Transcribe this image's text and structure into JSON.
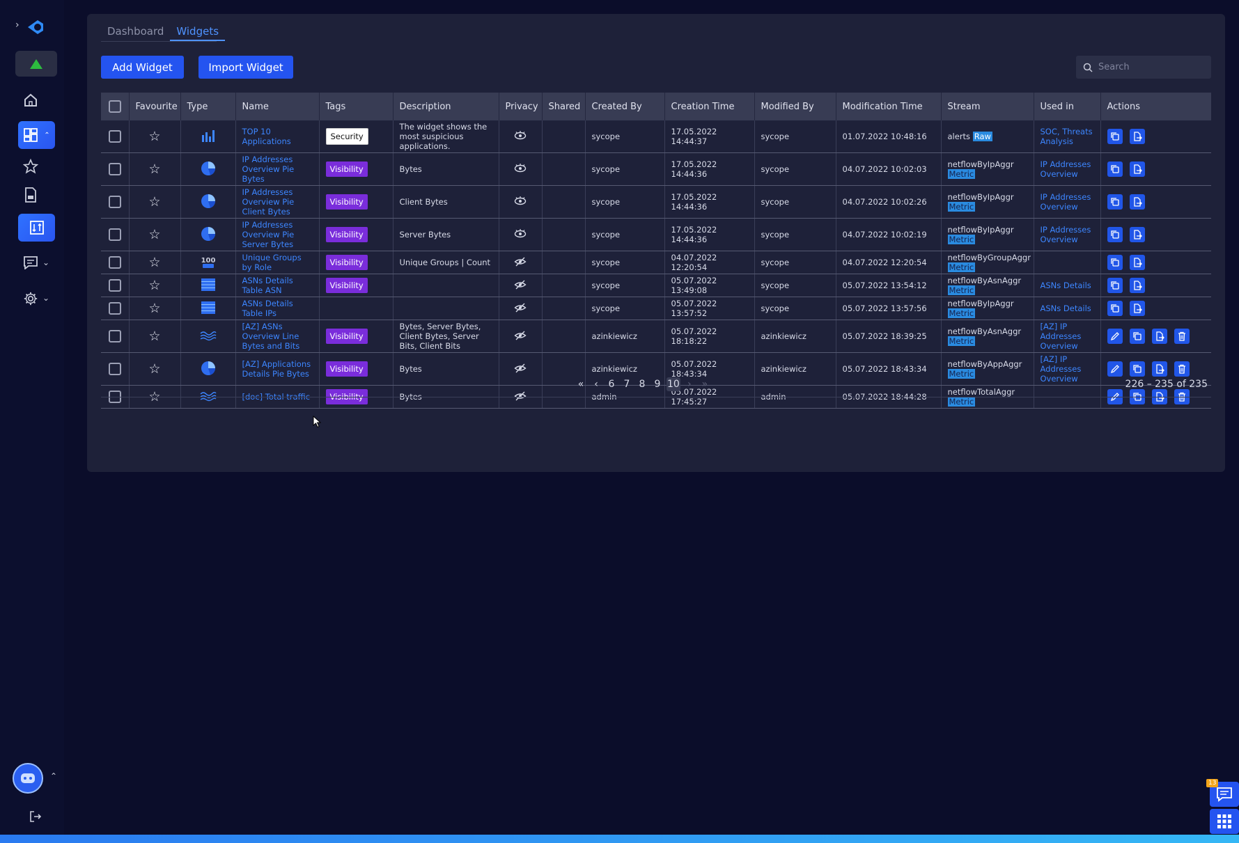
{
  "tabs": [
    {
      "label": "Dashboard",
      "active": false
    },
    {
      "label": "Widgets",
      "active": true
    }
  ],
  "buttons": {
    "add": "Add Widget",
    "import": "Import Widget"
  },
  "search": {
    "placeholder": "Search"
  },
  "columns": [
    "Favourite",
    "Type",
    "Name",
    "Tags",
    "Description",
    "Privacy",
    "Shared",
    "Created By",
    "Creation Time",
    "Modified By",
    "Modification Time",
    "Stream",
    "Used in",
    "Actions"
  ],
  "rows": [
    {
      "type": "bar",
      "name": "TOP 10 Applications",
      "tag": "Security",
      "description": "The widget shows the most suspicious applications.",
      "privacy": "visible",
      "created_by": "sycope",
      "created": "17.05.2022 14:44:37",
      "modified_by": "sycope",
      "modified": "01.07.2022 10:48:16",
      "stream": "alerts",
      "stream_tag": "Raw",
      "used_in": "SOC, Threats Analysis",
      "actions": [
        "copy",
        "export"
      ]
    },
    {
      "type": "pie",
      "name": "IP Addresses Overview Pie Bytes",
      "tag": "Visibility",
      "description": "Bytes",
      "privacy": "visible",
      "created_by": "sycope",
      "created": "17.05.2022 14:44:36",
      "modified_by": "sycope",
      "modified": "04.07.2022 10:02:03",
      "stream": "netflowByIpAggr",
      "stream_tag": "Metric",
      "used_in": "IP Addresses Overview",
      "actions": [
        "copy",
        "export"
      ]
    },
    {
      "type": "pie",
      "name": "IP Addresses Overview Pie Client Bytes",
      "tag": "Visibility",
      "description": "Client Bytes",
      "privacy": "visible",
      "created_by": "sycope",
      "created": "17.05.2022 14:44:36",
      "modified_by": "sycope",
      "modified": "04.07.2022 10:02:26",
      "stream": "netflowByIpAggr",
      "stream_tag": "Metric",
      "used_in": "IP Addresses Overview",
      "actions": [
        "copy",
        "export"
      ]
    },
    {
      "type": "pie",
      "name": "IP Addresses Overview Pie Server Bytes",
      "tag": "Visibility",
      "description": "Server Bytes",
      "privacy": "visible",
      "created_by": "sycope",
      "created": "17.05.2022 14:44:36",
      "modified_by": "sycope",
      "modified": "04.07.2022 10:02:19",
      "stream": "netflowByIpAggr",
      "stream_tag": "Metric",
      "used_in": "IP Addresses Overview",
      "actions": [
        "copy",
        "export"
      ]
    },
    {
      "type": "number",
      "name": "Unique Groups by Role",
      "tag": "Visibility",
      "description": "Unique Groups | Count",
      "privacy": "hidden",
      "created_by": "sycope",
      "created": "04.07.2022 12:20:54",
      "modified_by": "sycope",
      "modified": "04.07.2022 12:20:54",
      "stream": "netflowByGroupAggr",
      "stream_tag": "Metric",
      "used_in": "",
      "actions": [
        "copy",
        "export"
      ]
    },
    {
      "type": "table",
      "name": "ASNs Details Table ASN",
      "tag": "Visibility",
      "description": "",
      "privacy": "hidden",
      "created_by": "sycope",
      "created": "05.07.2022 13:49:08",
      "modified_by": "sycope",
      "modified": "05.07.2022 13:54:12",
      "stream": "netflowByAsnAggr",
      "stream_tag": "Metric",
      "used_in": "ASNs Details",
      "actions": [
        "copy",
        "export"
      ]
    },
    {
      "type": "table",
      "name": "ASNs Details Table IPs",
      "tag": "",
      "description": "",
      "privacy": "hidden",
      "created_by": "sycope",
      "created": "05.07.2022 13:57:52",
      "modified_by": "sycope",
      "modified": "05.07.2022 13:57:56",
      "stream": "netflowByIpAggr",
      "stream_tag": "Metric",
      "used_in": "ASNs Details",
      "actions": [
        "copy",
        "export"
      ]
    },
    {
      "type": "line",
      "name": "[AZ] ASNs Overview Line Bytes and Bits",
      "tag": "Visibility",
      "description": "Bytes, Server Bytes, Client Bytes, Server Bits, Client Bits",
      "privacy": "hidden",
      "created_by": "azinkiewicz",
      "created": "05.07.2022 18:18:22",
      "modified_by": "azinkiewicz",
      "modified": "05.07.2022 18:39:25",
      "stream": "netflowByAsnAggr",
      "stream_tag": "Metric",
      "used_in": "[AZ] IP Addresses Overview",
      "actions": [
        "edit",
        "copy",
        "export",
        "delete"
      ]
    },
    {
      "type": "pie",
      "name": "[AZ] Applications Details Pie Bytes",
      "tag": "Visibility",
      "description": "Bytes",
      "privacy": "hidden",
      "created_by": "azinkiewicz",
      "created": "05.07.2022 18:43:34",
      "modified_by": "azinkiewicz",
      "modified": "05.07.2022 18:43:34",
      "stream": "netflowByAppAggr",
      "stream_tag": "Metric",
      "used_in": "[AZ] IP Addresses Overview",
      "actions": [
        "edit",
        "copy",
        "export",
        "delete"
      ]
    },
    {
      "type": "line",
      "name": "[doc] Total traffic",
      "tag": "Visibility",
      "description": "Bytes",
      "privacy": "hidden",
      "created_by": "admin",
      "created": "05.07.2022 17:45:27",
      "modified_by": "admin",
      "modified": "05.07.2022 18:44:28",
      "stream": "netflowTotalAggr",
      "stream_tag": "Metric",
      "used_in": "",
      "actions": [
        "edit",
        "copy",
        "export",
        "delete"
      ]
    }
  ],
  "pagination": {
    "pages": [
      "6",
      "7",
      "8",
      "9",
      "10"
    ],
    "current": "10",
    "range": "226 – 235 of 235"
  },
  "notifications": {
    "count": "13"
  },
  "colors": {
    "accent": "#2454f0",
    "link": "#3d86ff",
    "visibility_tag": "#7a2ddb",
    "metric_tag": "#2a8be0"
  }
}
